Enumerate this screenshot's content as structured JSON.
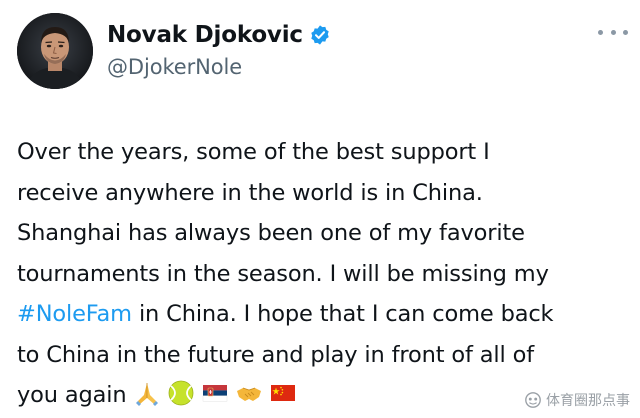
{
  "author": {
    "display_name": "Novak Djokovic",
    "handle": "@DjokerNole",
    "verified": true
  },
  "tweet": {
    "line1": "Over the years, some of the best support I",
    "line2": "receive anywhere in the world is in China.",
    "line3": "Shanghai has always been one of my favorite",
    "line4": "tournaments in the season. I will be missing my",
    "line5_hashtag": "#NoleFam",
    "line5_rest": " in China. I hope that I can come back",
    "line6": "to China in the future and play in front of all of",
    "line7": "you again",
    "emojis": [
      "folded-hands",
      "tennis-ball",
      "serbia-flag",
      "handshake",
      "china-flag"
    ]
  },
  "watermark": {
    "text": "体育圈那点事"
  },
  "colors": {
    "text": "#0f1419",
    "secondary": "#536471",
    "link": "#1d9bf0",
    "verified": "#1d9bf0"
  }
}
